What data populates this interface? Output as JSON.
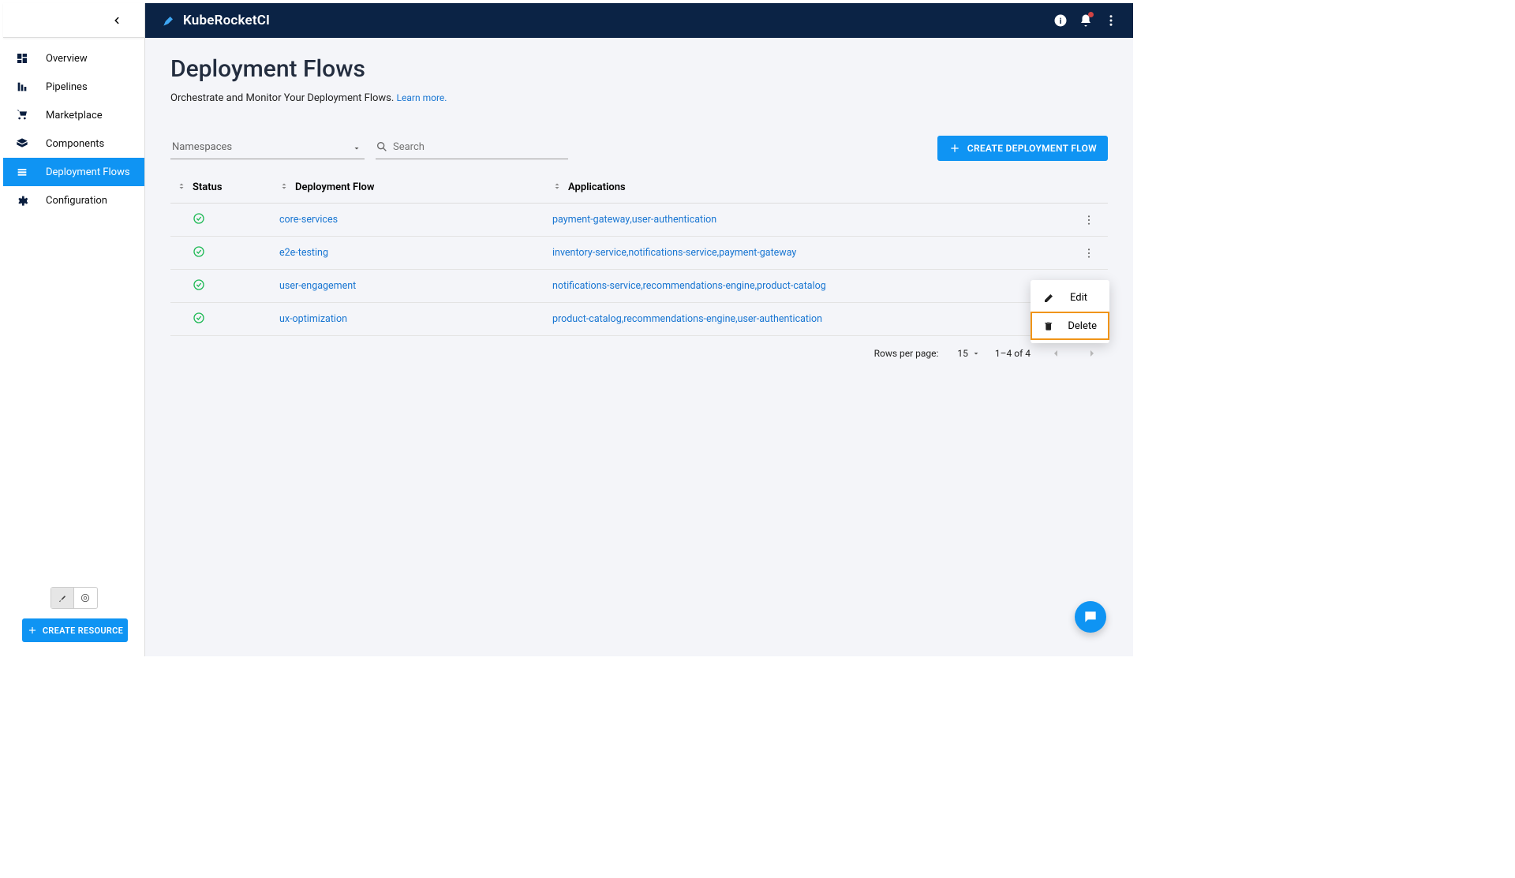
{
  "brand": "KubeRocketCI",
  "sidebar": {
    "items": [
      {
        "label": "Overview"
      },
      {
        "label": "Pipelines"
      },
      {
        "label": "Marketplace"
      },
      {
        "label": "Components"
      },
      {
        "label": "Deployment Flows"
      },
      {
        "label": "Configuration"
      }
    ],
    "create_resource_label": "CREATE RESOURCE"
  },
  "page": {
    "title": "Deployment Flows",
    "subtitle": "Orchestrate and Monitor Your Deployment Flows.",
    "learn_more": "Learn more."
  },
  "filters": {
    "namespaces_label": "Namespaces",
    "search_placeholder": "Search"
  },
  "create_flow_label": "CREATE DEPLOYMENT FLOW",
  "table": {
    "columns": {
      "status": "Status",
      "flow": "Deployment Flow",
      "apps": "Applications"
    },
    "rows": [
      {
        "flow": "core-services",
        "apps": [
          "payment-gateway",
          "user-authentication"
        ]
      },
      {
        "flow": "e2e-testing",
        "apps": [
          "inventory-service",
          "notifications-service",
          "payment-gateway"
        ]
      },
      {
        "flow": "user-engagement",
        "apps": [
          "notifications-service",
          "recommendations-engine",
          "product-catalog"
        ]
      },
      {
        "flow": "ux-optimization",
        "apps": [
          "product-catalog",
          "recommendations-engine",
          "user-authentication"
        ]
      }
    ]
  },
  "pagination": {
    "rows_per_page_label": "Rows per page:",
    "rows_per_page_value": "15",
    "range": "1–4 of 4"
  },
  "context_menu": {
    "edit": "Edit",
    "delete": "Delete"
  }
}
